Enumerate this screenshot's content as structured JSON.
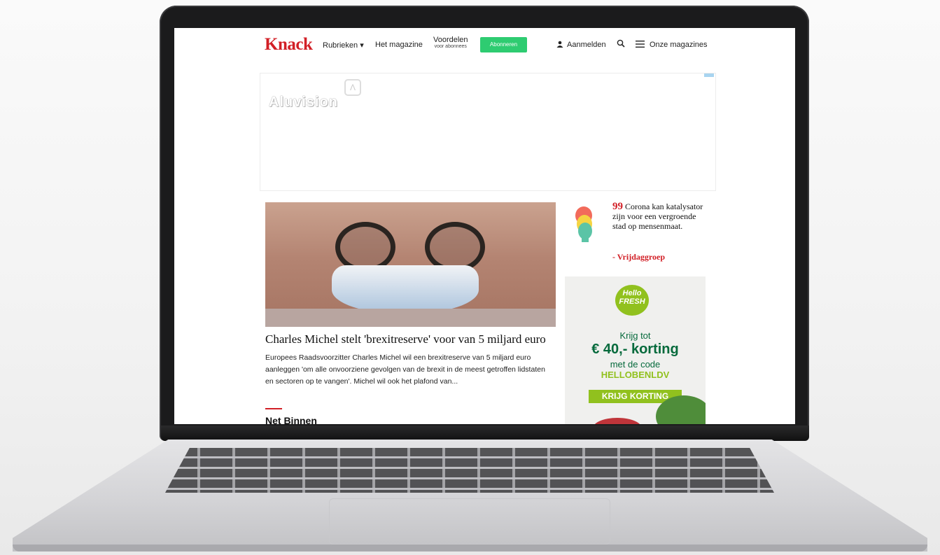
{
  "nav": {
    "logo": "Knack",
    "rubrieken": "Rubrieken ▾",
    "magazine": "Het magazine",
    "voordelen": "Voordelen",
    "voordelen_sub": "voor abonnees",
    "abonneren": "Abonneren",
    "aanmelden": "Aanmelden",
    "magazines": "Onze magazines"
  },
  "ad_banner": {
    "brand": "Aluvision",
    "mark": "Λ"
  },
  "article": {
    "headline": "Charles Michel stelt 'brexitreserve' voor van 5 miljard euro",
    "summary": "Europees Raadsvoorzitter Charles Michel wil een brexitreserve van 5 miljard euro aanleggen 'om alle onvoorziene gevolgen van de brexit in de meest getroffen lidstaten en sectoren op te vangen'. Michel wil ook het plafond van..."
  },
  "section": {
    "title": "Net Binnen"
  },
  "quote": {
    "mark": "99",
    "text": "Corona kan katalysator zijn voor een vergroende stad op mensenmaat.",
    "author": "- Vrijdaggroep"
  },
  "hellofresh_ad": {
    "logo_line1": "Hello",
    "logo_line2": "FRESH",
    "line1": "Krijg tot",
    "line2": "€ 40,- korting",
    "line3": "met de code",
    "line4": "HELLOBENLDV",
    "button": "KRIJG KORTING"
  },
  "colors": {
    "brand_red": "#d21f26",
    "subscribe_green": "#2ecc71",
    "hellofresh_green": "#91c11e"
  }
}
